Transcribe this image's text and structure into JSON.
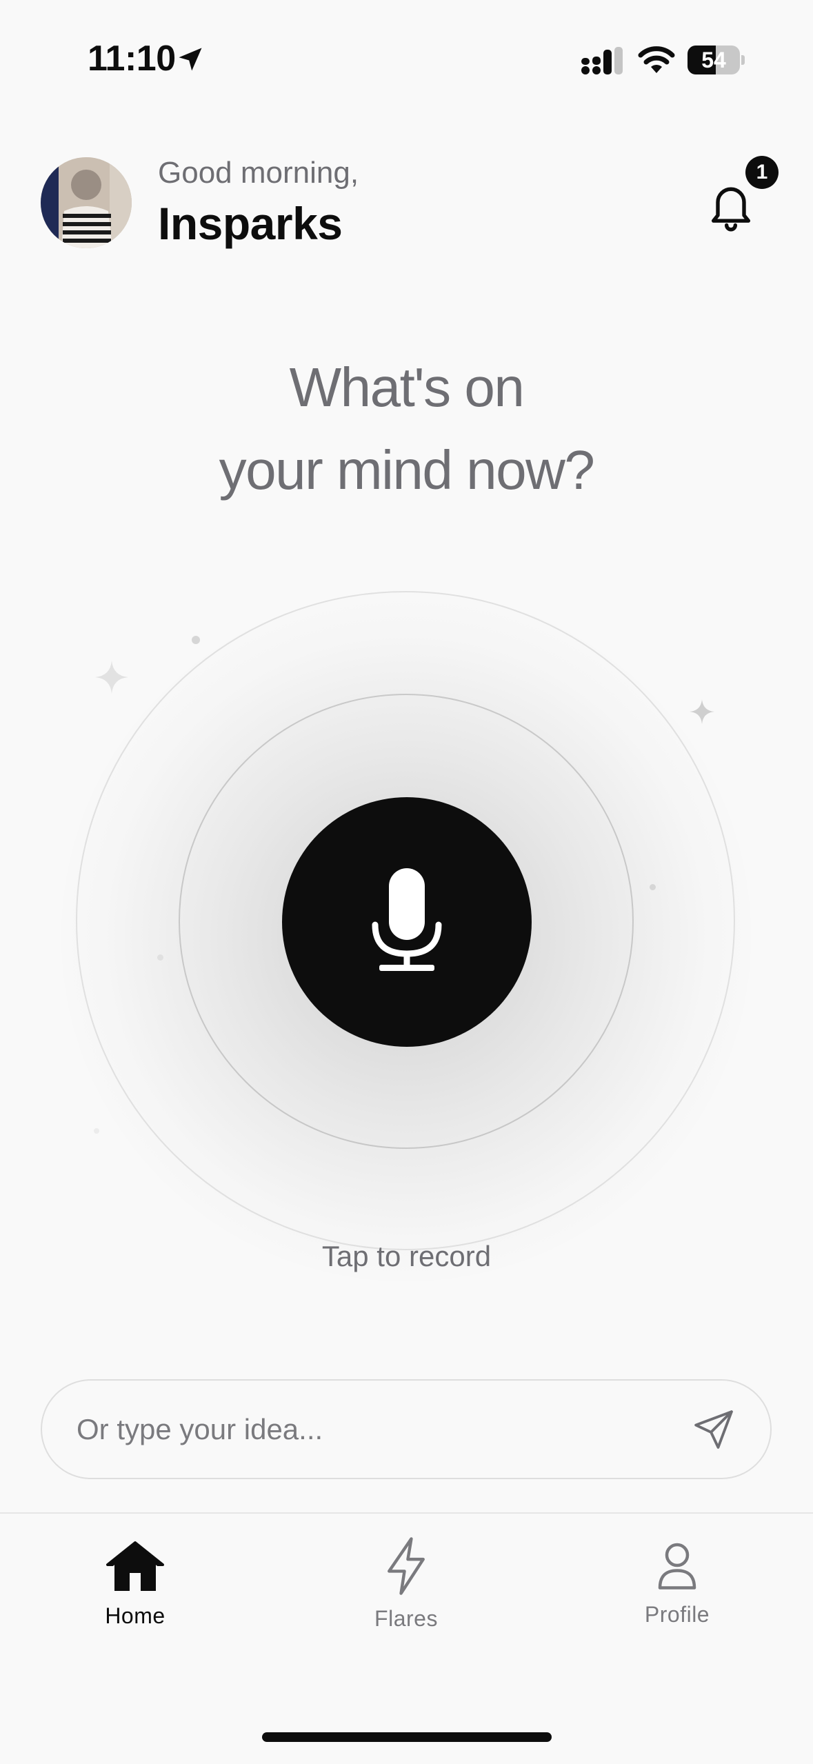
{
  "status_bar": {
    "time": "11:10",
    "battery_level": "54",
    "battery_fraction": 0.54
  },
  "header": {
    "greeting": "Good morning,",
    "username": "Insparks",
    "notification_count": "1"
  },
  "prompt": {
    "line1": "What's on",
    "line2": "your mind now?"
  },
  "record": {
    "hint": "Tap to record"
  },
  "idea_input": {
    "placeholder": "Or type your idea..."
  },
  "tab_bar": {
    "tabs": [
      {
        "label": "Home",
        "icon": "home-icon",
        "active": true
      },
      {
        "label": "Flares",
        "icon": "bolt-icon",
        "active": false
      },
      {
        "label": "Profile",
        "icon": "person-icon",
        "active": false
      }
    ]
  },
  "colors": {
    "background": "#f9f9f9",
    "primary": "#0d0d0d",
    "muted_text": "#6e6e73",
    "inactive_tab": "#7a7a7e"
  }
}
